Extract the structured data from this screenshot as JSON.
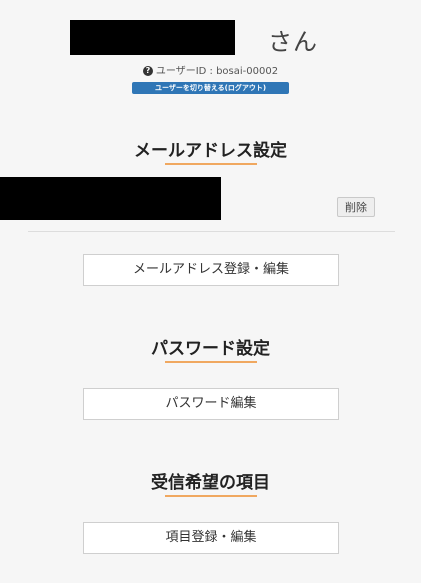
{
  "user": {
    "name_suffix": "さん",
    "id_text": "ユーザーID : bosai-00002",
    "switch_label": "ユーザーを切り替える(ログアウト)"
  },
  "email_section": {
    "title": "メールアドレス設定",
    "delete_label": "削除",
    "edit_button": "メールアドレス登録・編集"
  },
  "password_section": {
    "title": "パスワード設定",
    "edit_button": "パスワード編集"
  },
  "subscription_section": {
    "title": "受信希望の項目",
    "edit_button": "項目登録・編集"
  },
  "colors": {
    "accent_line": "#f0a860",
    "badge_bg": "#2f76b6",
    "redaction": "#000000"
  },
  "icons": {
    "help": "help-circle-icon"
  }
}
